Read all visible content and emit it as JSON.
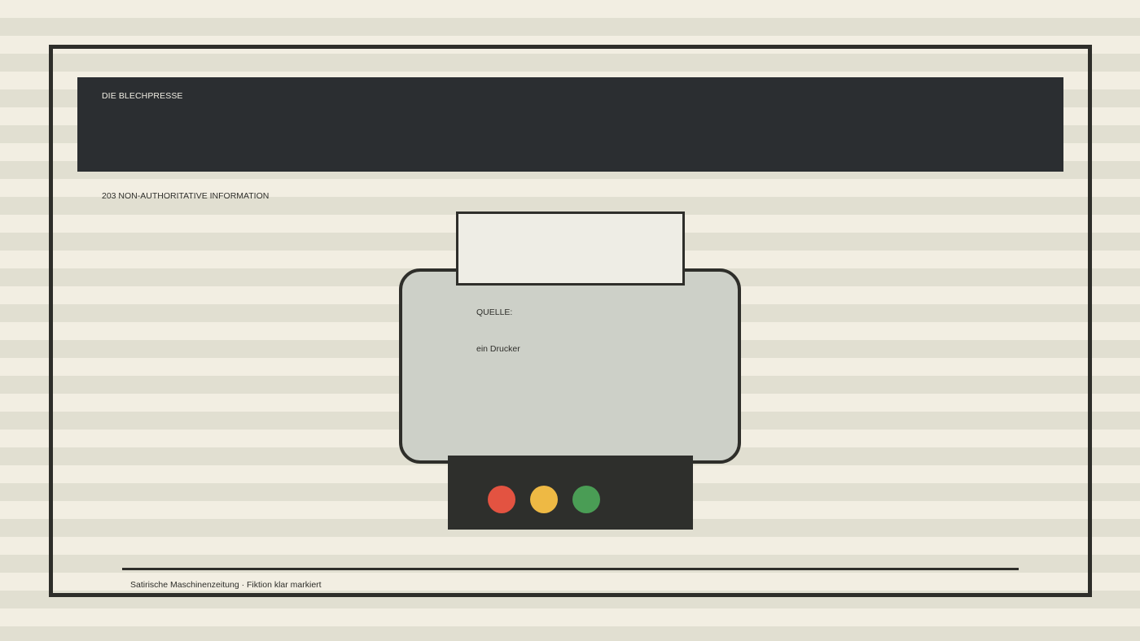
{
  "masthead": {
    "title": "DIE BLECHPRESSE"
  },
  "status": {
    "text": "203 NON-AUTHORITATIVE INFORMATION"
  },
  "printer": {
    "source_label": "QUELLE:",
    "source_value": "ein Drucker",
    "lights": [
      {
        "name": "red",
        "color": "#e35341"
      },
      {
        "name": "yellow",
        "color": "#eeb944"
      },
      {
        "name": "green",
        "color": "#4a9d55"
      }
    ]
  },
  "footer": {
    "text": "Satirische Maschinenzeitung · Fiktion klar markiert"
  },
  "colors": {
    "background_light": "#f2eee2",
    "background_stripe": "#e1dfd1",
    "ink": "#2e2e2a",
    "masthead_bg": "#2b2e31",
    "printer_body": "#cdd0c8",
    "paper": "#eeede5"
  }
}
